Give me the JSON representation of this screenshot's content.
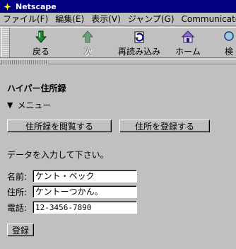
{
  "window": {
    "title": "Netscape"
  },
  "menubar": [
    {
      "label": "ファイル(F)"
    },
    {
      "label": "編集(E)"
    },
    {
      "label": "表示(V)"
    },
    {
      "label": "ジャンプ(G)"
    },
    {
      "label": "Communicator(C)"
    }
  ],
  "toolbar": {
    "back": {
      "label": "戻る",
      "icon": "back-arrow-icon"
    },
    "forward": {
      "label": "次",
      "icon": "forward-arrow-icon"
    },
    "reload": {
      "label": "再読み込み",
      "icon": "reload-icon"
    },
    "home": {
      "label": "ホーム",
      "icon": "home-icon"
    },
    "search": {
      "label": "検",
      "icon": "search-icon"
    }
  },
  "page": {
    "title": "ハイパー住所録",
    "menu_toggle": "メニュー",
    "browse_button": "住所録を閲覧する",
    "register_address_button": "住所を登録する",
    "instruction": "データを入力して下さい。",
    "fields": {
      "name": {
        "label": "名前:",
        "value": "ケント・ベック"
      },
      "address": {
        "label": "住所:",
        "value": "ケントーつかん。"
      },
      "phone": {
        "label": "電話:",
        "value": "12-3456-7890"
      }
    },
    "submit_button": "登録"
  },
  "colors": {
    "titlebar": "#000080",
    "chrome": "#c0c0c0",
    "toolbar_icon_green": "#1a8a3a"
  }
}
